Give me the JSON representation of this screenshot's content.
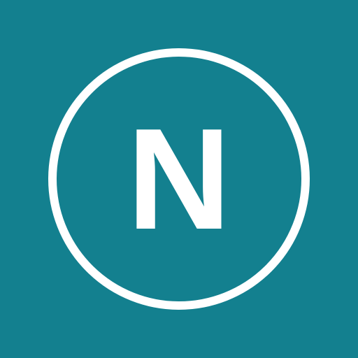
{
  "app_icon": {
    "letter": "N",
    "background_color": "#13808f",
    "foreground_color": "#ffffff",
    "ring_icon": "circle-outline-icon"
  }
}
